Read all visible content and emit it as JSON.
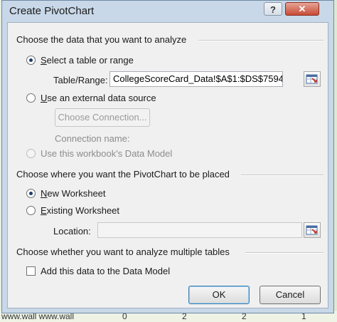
{
  "window": {
    "title": "Create PivotChart",
    "help_label": "?",
    "close_label": "✕"
  },
  "section1": {
    "title": "Choose the data that you want to analyze",
    "select_table": {
      "prefix": "",
      "accel": "S",
      "rest": "elect a table or range",
      "checked": true
    },
    "table_range_label": "Table/Range:",
    "table_range_value": "CollegeScoreCard_Data!$A$1:$DS$7594",
    "external": {
      "accel": "U",
      "rest": "se an external data source",
      "checked": false
    },
    "choose_connection": "Choose Connection...",
    "connection_name_label": "Connection name:",
    "data_model": {
      "label": "Use this workbook's Data Model",
      "checked": false,
      "enabled": false
    }
  },
  "section2": {
    "title": "Choose where you want the PivotChart to be placed",
    "new_worksheet": {
      "accel": "N",
      "rest": "ew Worksheet",
      "checked": true
    },
    "existing_worksheet": {
      "accel": "E",
      "rest": "xisting Worksheet",
      "checked": false
    },
    "location_label": "Location:",
    "location_value": ""
  },
  "section3": {
    "title": "Choose whether you want to analyze multiple tables",
    "add_data_model": {
      "label": "Add this data to the Data Model",
      "checked": false
    }
  },
  "buttons": {
    "ok": "OK",
    "cancel": "Cancel"
  },
  "background": {
    "row_text": "www.wall www.wall",
    "numbers": [
      "0",
      "2",
      "2",
      "1"
    ]
  },
  "colors": {
    "accent": "#3c7fb1",
    "close": "#c84b36"
  }
}
